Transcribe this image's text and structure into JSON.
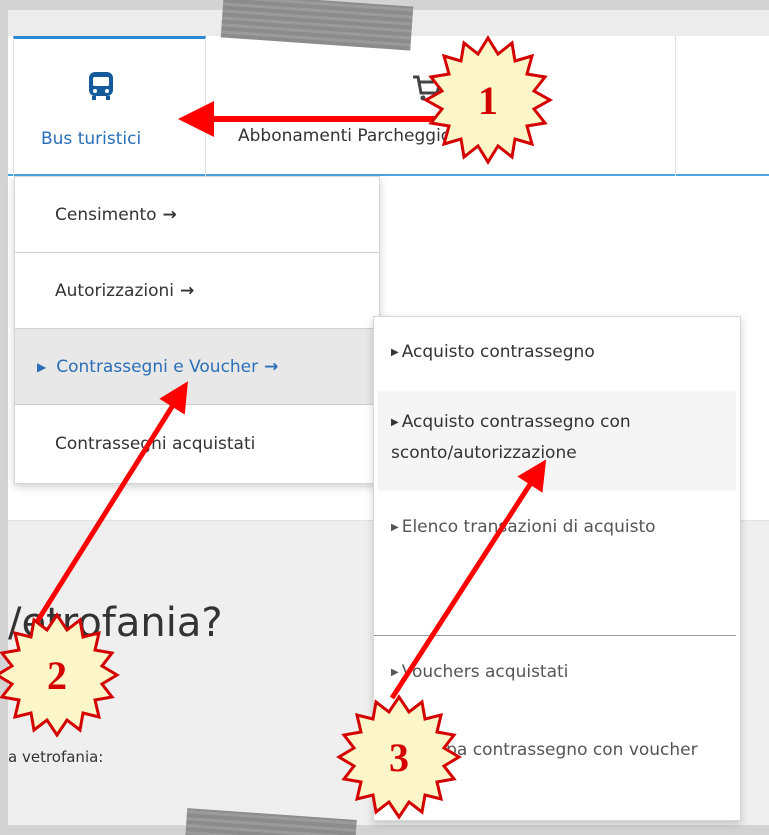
{
  "tabs": [
    {
      "icon": "bus-icon",
      "label": "Bus turistici"
    },
    {
      "icon": "cart-icon",
      "label": "Abbonamenti Parcheggio Guidoni"
    }
  ],
  "menu": {
    "items": [
      {
        "label": "Censimento",
        "arrow": "→"
      },
      {
        "label": "Autorizzazioni",
        "arrow": "→"
      },
      {
        "label": "Contrassegni e Voucher",
        "arrow": "→",
        "active": true
      },
      {
        "label": "Contrassegni acquistati"
      }
    ],
    "submenu": [
      {
        "label": "Acquisto contrassegno"
      },
      {
        "label": "Acquisto contrassegno con sconto/autorizzazione"
      },
      {
        "label": "Elenco transazioni di acquisto"
      },
      {
        "label": "Vouchers acquistati"
      },
      {
        "label": "Stampa contrassegno con voucher"
      }
    ]
  },
  "content": {
    "heading": "/etrofania?",
    "subtext": "a vetrofania:"
  },
  "annotations": {
    "badges": [
      "1",
      "2",
      "3"
    ],
    "arrow_color": "#ff0000",
    "badge_fill": "#fdf6c8",
    "badge_stroke": "#d40000"
  }
}
